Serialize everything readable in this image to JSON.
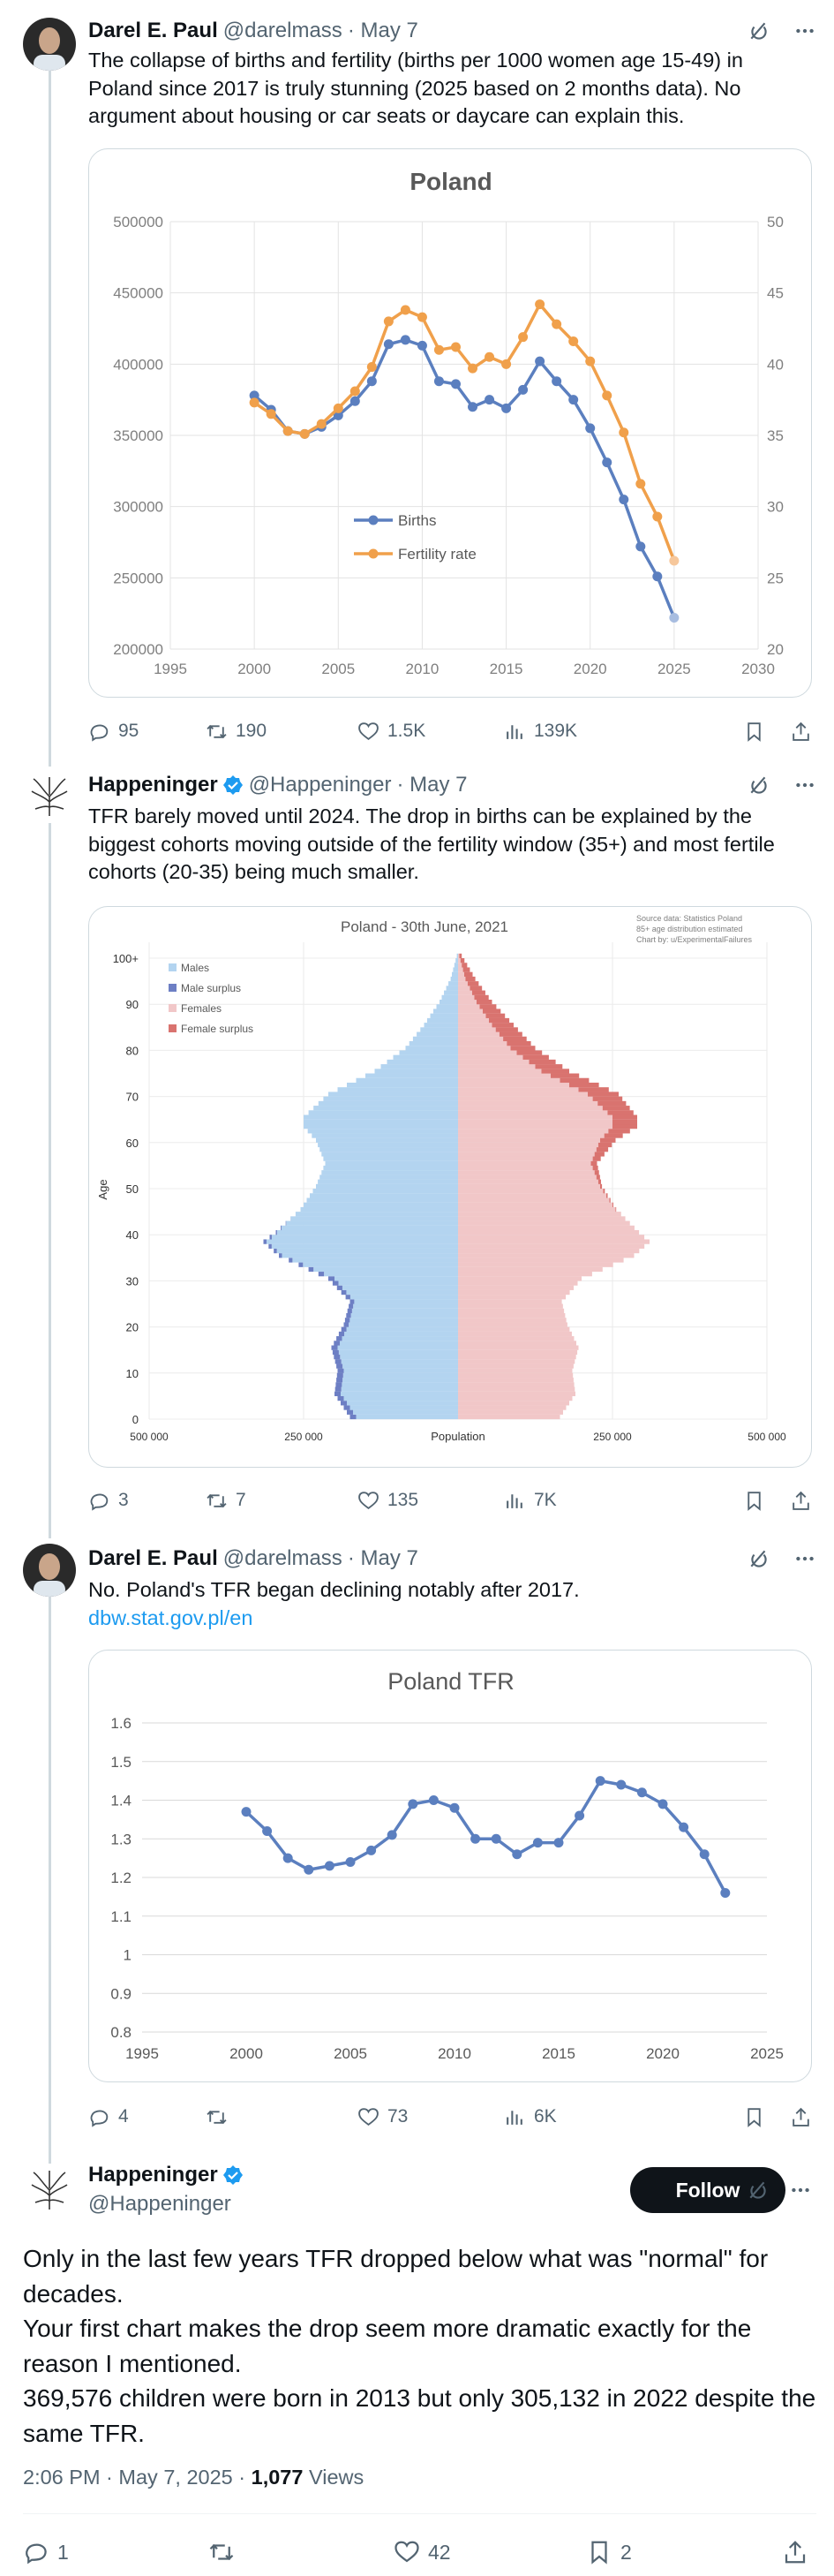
{
  "posts": [
    {
      "author": "Darel E. Paul",
      "handle": "@darelmass",
      "date": "· May 7",
      "text": "The collapse of births and fertility (births per 1000 women age 15-49) in Poland since 2017 is truly stunning (2025 based on 2 months data). No argument about housing or car seats or daycare can explain this.",
      "stats": {
        "replies": "95",
        "reposts": "190",
        "likes": "1.5K",
        "views": "139K"
      }
    },
    {
      "author": "Happeninger",
      "handle": "@Happeninger",
      "date": "· May 7",
      "text": "TFR barely moved until 2024. The drop in births can be explained by the biggest cohorts moving outside of the fertility window (35+) and most fertile cohorts (20-35) being much smaller.",
      "stats": {
        "replies": "3",
        "reposts": "7",
        "likes": "135",
        "views": "7K"
      }
    },
    {
      "author": "Darel E. Paul",
      "handle": "@darelmass",
      "date": "· May 7",
      "text": "No. Poland's TFR began declining notably after 2017.",
      "link": "dbw.stat.gov.pl/en",
      "stats": {
        "replies": "4",
        "reposts": "",
        "likes": "73",
        "views": "6K"
      }
    }
  ],
  "main_post": {
    "author": "Happeninger",
    "handle": "@Happeninger",
    "follow_label": "Follow",
    "text_lines": [
      "Only in the last few years TFR dropped below what was \"normal\" for decades.",
      "Your first chart makes the drop seem more dramatic exactly for the reason I mentioned.",
      "369,576  children were born in 2013 but only 305,132 in 2022 despite the same TFR."
    ],
    "time": "2:06 PM · May 7, 2025 ·",
    "views_count": "1,077",
    "views_label": "Views",
    "stats": {
      "replies": "1",
      "reposts": "",
      "likes": "42",
      "bookmarks": "2"
    }
  },
  "colors": {
    "blue_series": "#5b7fbf",
    "orange_series": "#f0a04b",
    "males": "#b3d4f0",
    "male_surplus": "#6d7fc4",
    "females": "#f1c7c8",
    "female_surplus": "#d9736f",
    "tfr_line": "#5b7fbf",
    "verified": "#1d9bf0"
  },
  "chart_data": [
    {
      "type": "line",
      "title": "Poland",
      "xlabel": "",
      "ylabel": "",
      "xlim": [
        1995,
        2030
      ],
      "ylim": [
        200000,
        500000
      ],
      "y2lim": [
        20,
        50
      ],
      "x_ticks": [
        "1995",
        "2000",
        "2005",
        "2010",
        "2015",
        "2020",
        "2025",
        "2030"
      ],
      "y_ticks": [
        "200000",
        "250000",
        "300000",
        "350000",
        "400000",
        "450000",
        "500000"
      ],
      "y2_ticks": [
        "20",
        "25",
        "30",
        "35",
        "40",
        "45",
        "50"
      ],
      "grid": true,
      "legend": "inside-center",
      "series": [
        {
          "name": "Births",
          "axis": "left",
          "x": [
            2000,
            2001,
            2002,
            2003,
            2004,
            2005,
            2006,
            2007,
            2008,
            2009,
            2010,
            2011,
            2012,
            2013,
            2014,
            2015,
            2016,
            2017,
            2018,
            2019,
            2020,
            2021,
            2022,
            2023,
            2024,
            2025
          ],
          "values": [
            378000,
            368000,
            353000,
            351000,
            356000,
            364000,
            374000,
            388000,
            414000,
            417000,
            413000,
            388000,
            386000,
            370000,
            375000,
            369000,
            382000,
            402000,
            388000,
            375000,
            355000,
            331000,
            305000,
            272000,
            251000,
            222000
          ]
        },
        {
          "name": "Fertility rate",
          "axis": "right",
          "x": [
            2000,
            2001,
            2002,
            2003,
            2004,
            2005,
            2006,
            2007,
            2008,
            2009,
            2010,
            2011,
            2012,
            2013,
            2014,
            2015,
            2016,
            2017,
            2018,
            2019,
            2020,
            2021,
            2022,
            2023,
            2024,
            2025
          ],
          "values": [
            37.3,
            36.5,
            35.3,
            35.1,
            35.8,
            36.9,
            38.1,
            39.8,
            43.0,
            43.8,
            43.3,
            41.0,
            41.2,
            39.7,
            40.5,
            40.0,
            41.9,
            44.2,
            42.8,
            41.6,
            40.2,
            37.8,
            35.2,
            31.6,
            29.3,
            26.2
          ]
        }
      ]
    },
    {
      "type": "bar",
      "title": "Poland - 30th June, 2021",
      "source_lines": [
        "Source data: Statistics Poland",
        "85+ age distribution estimated",
        "Chart by: u/ExperimentalFailures"
      ],
      "xlabel": "Population",
      "ylabel": "Age",
      "x_ticks_left": [
        "500 000",
        "250 000"
      ],
      "x_ticks_right": [
        "250 000",
        "500 000"
      ],
      "age_ticks": [
        "0",
        "10",
        "20",
        "30",
        "40",
        "50",
        "60",
        "70",
        "80",
        "90",
        "100+"
      ],
      "legend": "top-left",
      "series": [
        {
          "name": "Males"
        },
        {
          "name": "Male surplus"
        },
        {
          "name": "Females"
        },
        {
          "name": "Female surplus"
        }
      ],
      "age_points": [
        0,
        5,
        10,
        15,
        20,
        25,
        30,
        35,
        38,
        40,
        45,
        50,
        55,
        60,
        63,
        65,
        70,
        75,
        80,
        85,
        90,
        95,
        100
      ],
      "males": [
        175000,
        200000,
        195000,
        205000,
        185000,
        175000,
        210000,
        290000,
        315000,
        295000,
        255000,
        230000,
        215000,
        230000,
        250000,
        250000,
        210000,
        135000,
        85000,
        55000,
        30000,
        12000,
        2000
      ],
      "females": [
        165000,
        190000,
        185000,
        195000,
        177000,
        168000,
        200000,
        285000,
        310000,
        293000,
        256000,
        233000,
        225000,
        255000,
        290000,
        290000,
        260000,
        180000,
        125000,
        90000,
        55000,
        28000,
        6000
      ]
    },
    {
      "type": "line",
      "title": "Poland TFR",
      "xlim": [
        1995,
        2025
      ],
      "ylim": [
        0.8,
        1.6
      ],
      "x_ticks": [
        "1995",
        "2000",
        "2005",
        "2010",
        "2015",
        "2020",
        "2025"
      ],
      "y_ticks": [
        "0.8",
        "0.9",
        "1",
        "1.1",
        "1.2",
        "1.3",
        "1.4",
        "1.5",
        "1.6"
      ],
      "grid": true,
      "series": [
        {
          "x": [
            2000,
            2001,
            2002,
            2003,
            2004,
            2005,
            2006,
            2007,
            2008,
            2009,
            2010,
            2011,
            2012,
            2013,
            2014,
            2015,
            2016,
            2017,
            2018,
            2019,
            2020,
            2021,
            2022,
            2023
          ],
          "values": [
            1.37,
            1.32,
            1.25,
            1.22,
            1.23,
            1.24,
            1.27,
            1.31,
            1.39,
            1.4,
            1.38,
            1.3,
            1.3,
            1.26,
            1.29,
            1.29,
            1.36,
            1.45,
            1.44,
            1.42,
            1.39,
            1.33,
            1.26,
            1.16
          ]
        }
      ]
    }
  ]
}
